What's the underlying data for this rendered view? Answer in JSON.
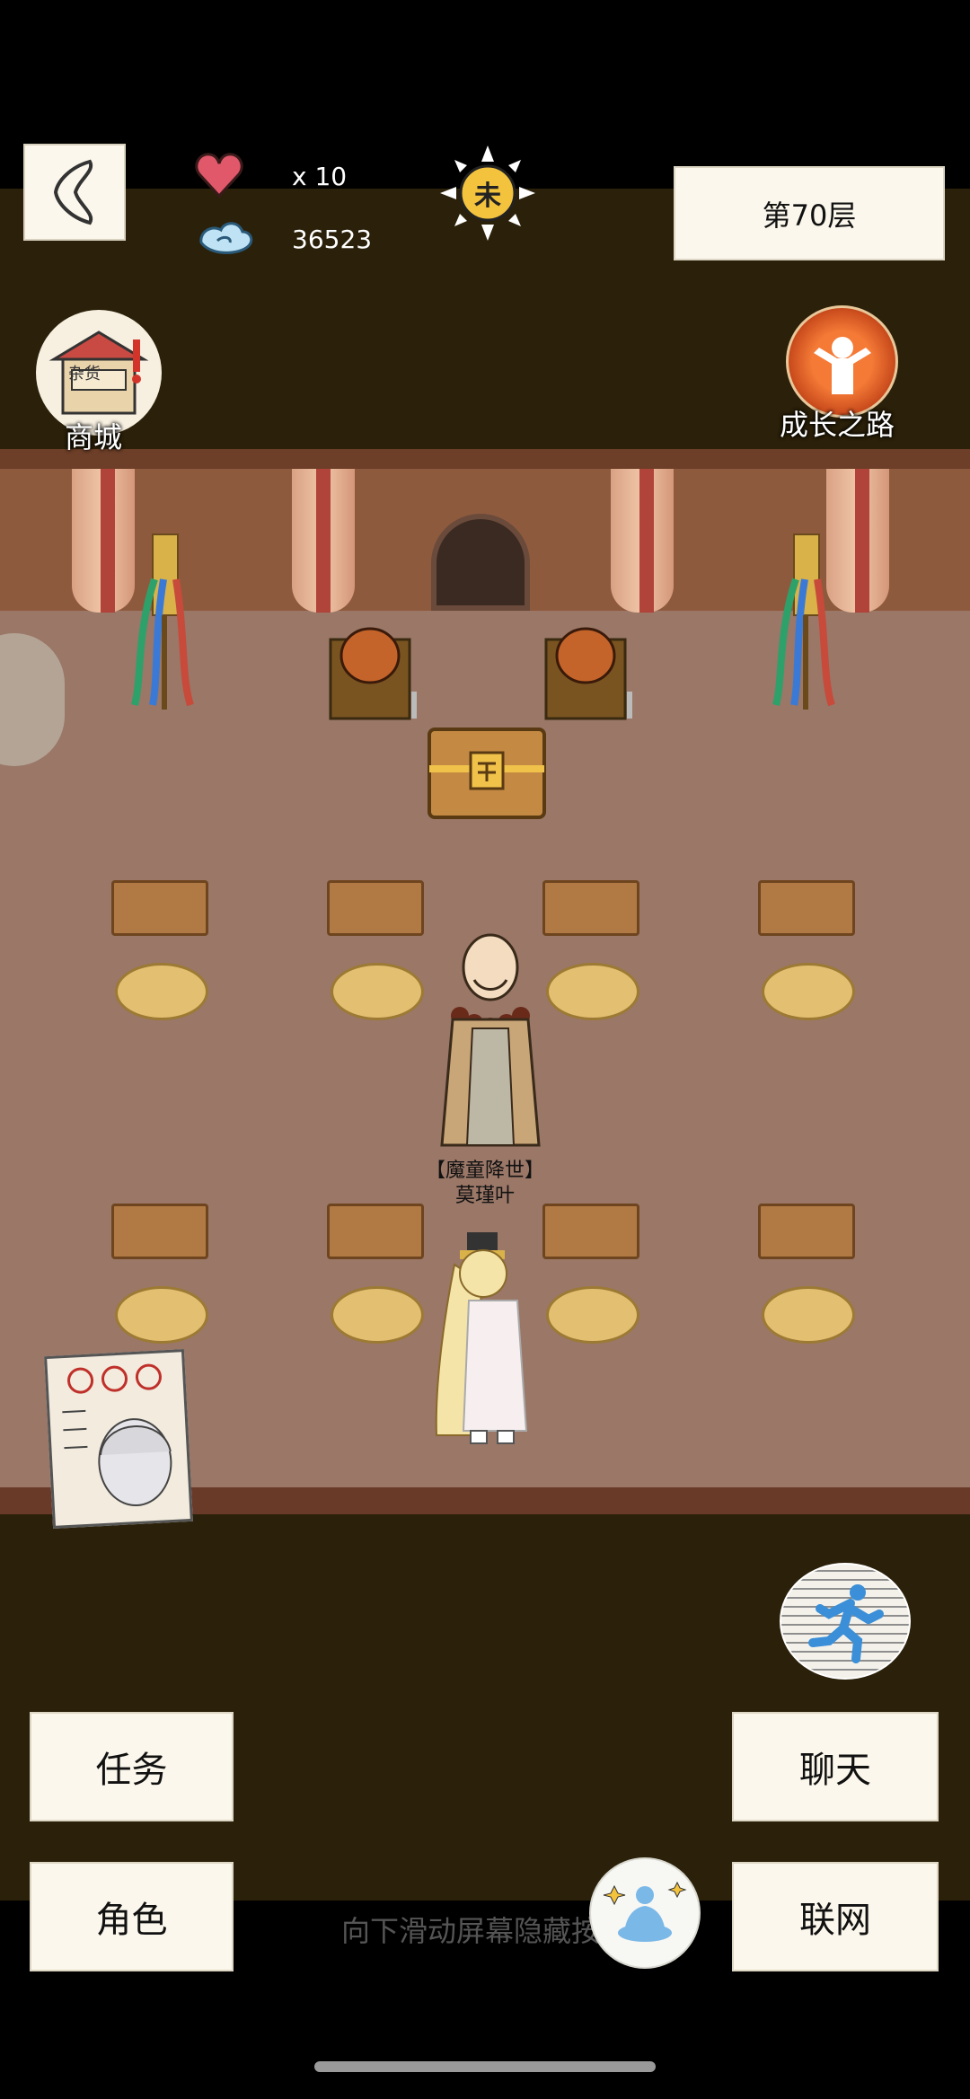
{
  "hud": {
    "hearts": "x 10",
    "coins": "36523",
    "time_glyph": "未",
    "floor": "第70层"
  },
  "shortcuts": {
    "shop_label": "商城",
    "shop_sign": "杂货",
    "growth_label": "成长之路"
  },
  "npc": {
    "title": "【魔童降世】",
    "name": "莫瑾叶"
  },
  "buttons": {
    "tasks": "任务",
    "character": "角色",
    "chat": "聊天",
    "network": "联网"
  },
  "hint": "向下滑动屏幕隐藏按钮",
  "colors": {
    "hud_bg": "#2b2009",
    "wall": "#8e5a3e",
    "floor": "#9a7767",
    "button_bg": "#fbf7ec"
  }
}
